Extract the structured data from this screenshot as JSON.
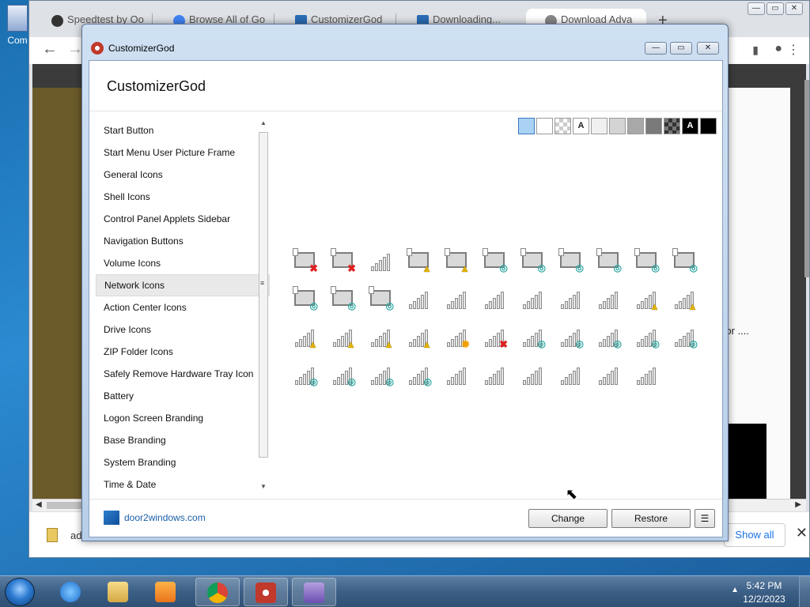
{
  "desktop": {
    "icon_label": "Com"
  },
  "chrome": {
    "tabs": [
      {
        "title": "Speedtest by Oo",
        "icon": "speedtest-icon"
      },
      {
        "title": "Browse All of Go",
        "icon": "google-icon"
      },
      {
        "title": "CustomizerGod",
        "icon": "site-icon"
      },
      {
        "title": "Downloading...",
        "icon": "site-icon"
      },
      {
        "title": "Download Adva",
        "icon": "site-icon"
      }
    ],
    "new_tab": "+",
    "page_cut_text": "d or ....",
    "download_item": "ad",
    "show_all": "Show all",
    "close": "✕"
  },
  "window": {
    "title": "CustomizerGod",
    "controls": {
      "minimize": "—",
      "maximize": "▭",
      "close": "✕"
    }
  },
  "app": {
    "title": "CustomizerGod",
    "sidebar": {
      "items": [
        "Start Button",
        "Start Menu User Picture Frame",
        "General Icons",
        "Shell Icons",
        "Control Panel Applets Sidebar",
        "Navigation Buttons",
        "Volume Icons",
        "Network Icons",
        "Action Center Icons",
        "Drive Icons",
        "ZIP Folder Icons",
        "Safely Remove Hardware Tray Icon",
        "Battery",
        "Logon Screen Branding",
        "Base Branding",
        "System Branding",
        "Time & Date"
      ],
      "selected": "Network Icons"
    },
    "swatches": [
      {
        "color": "#a9d2f5",
        "label": ""
      },
      {
        "color": "#ffffff",
        "label": ""
      },
      {
        "color": "checker",
        "label": ""
      },
      {
        "color": "#ffffff",
        "label": "A"
      },
      {
        "color": "#f0f0f0",
        "label": ""
      },
      {
        "color": "#d4d4d4",
        "label": ""
      },
      {
        "color": "#a8a8a8",
        "label": ""
      },
      {
        "color": "#7a7a7a",
        "label": ""
      },
      {
        "color": "darkchecker",
        "label": ""
      },
      {
        "color": "#000000",
        "label": "A"
      },
      {
        "color": "#000000",
        "label": ""
      }
    ],
    "footer": {
      "link": "door2windows.com",
      "change": "Change",
      "restore": "Restore",
      "menu": "☰"
    }
  },
  "taskbar": {
    "time": "5:42 PM",
    "date": "12/2/2023"
  }
}
